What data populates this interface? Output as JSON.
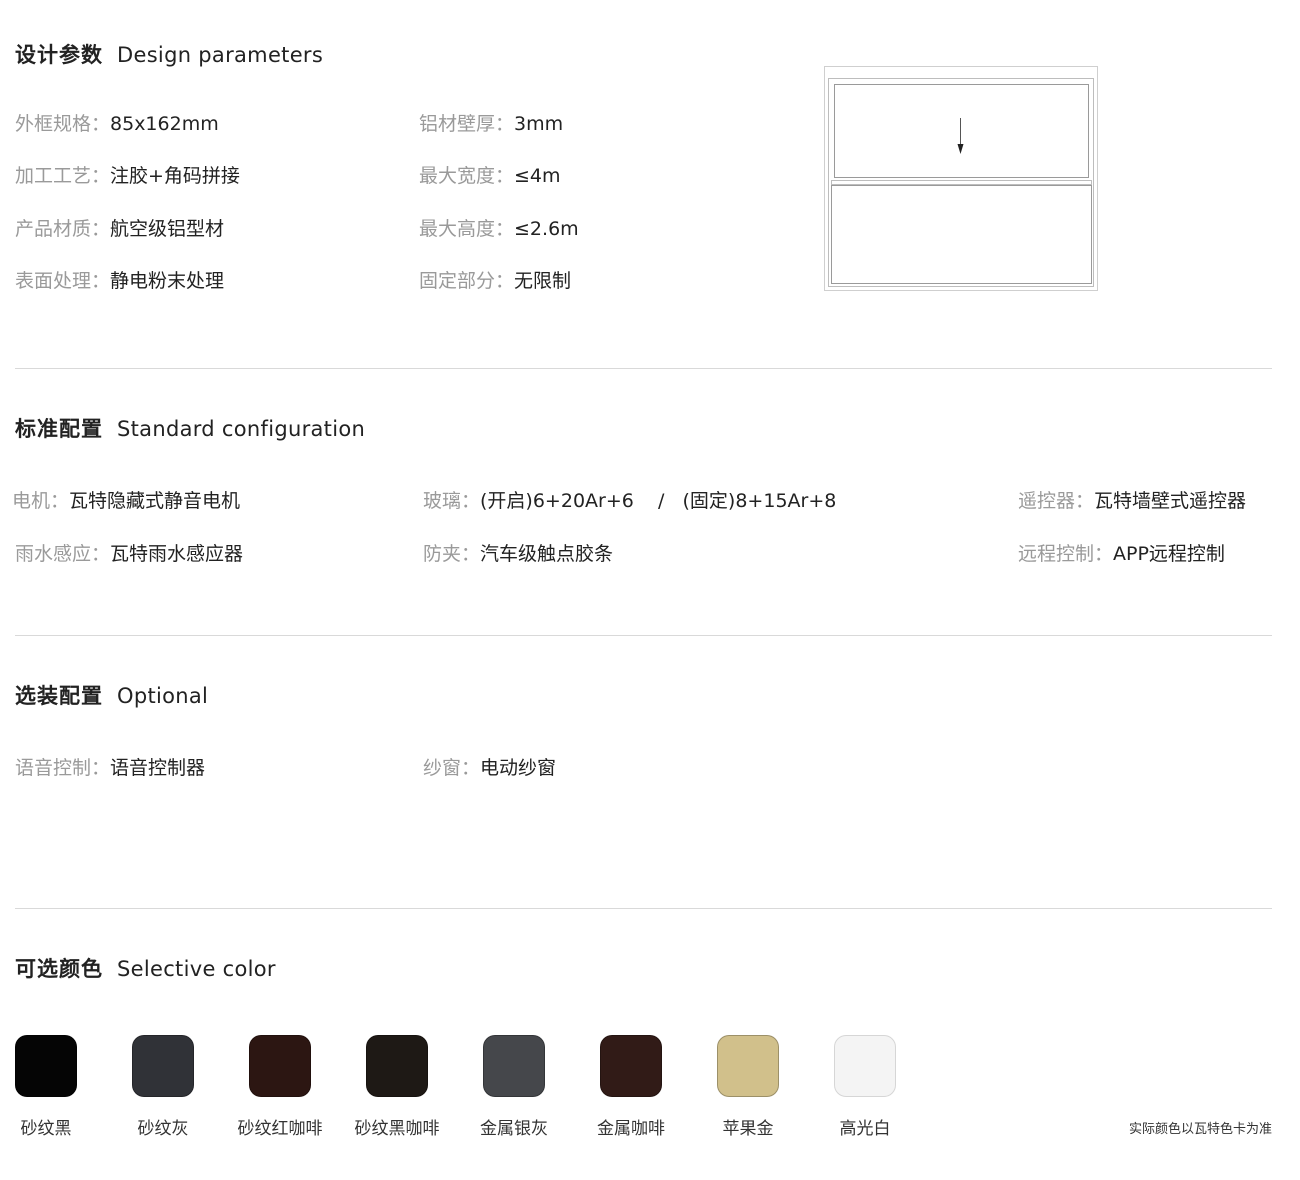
{
  "design": {
    "title": "设计参数",
    "subtitle": "Design parameters",
    "params": [
      {
        "k": "外框规格：",
        "v": "85x162mm"
      },
      {
        "k": "加工工艺：",
        "v": "注胶+角码拼接"
      },
      {
        "k": "产品材质：",
        "v": "航空级铝型材"
      },
      {
        "k": "表面处理：",
        "v": "静电粉末处理"
      },
      {
        "k": "铝材壁厚：",
        "v": "3mm"
      },
      {
        "k": "最大宽度：",
        "v": "≤4m"
      },
      {
        "k": "最大高度：",
        "v": "≤2.6m"
      },
      {
        "k": "固定部分：",
        "v": "无限制"
      }
    ]
  },
  "standard": {
    "title": "标准配置",
    "subtitle": "Standard configuration",
    "params": [
      {
        "k": "电机：",
        "v": "瓦特隐藏式静音电机"
      },
      {
        "k": "雨水感应：",
        "v": "瓦特雨水感应器"
      },
      {
        "k": "玻璃：",
        "v": "(开启)6+20Ar+6    /   (固定)8+15Ar+8"
      },
      {
        "k": "防夹：",
        "v": "汽车级触点胶条"
      },
      {
        "k": "遥控器：",
        "v": "瓦特墙壁式遥控器"
      },
      {
        "k": "远程控制：",
        "v": "APP远程控制"
      }
    ]
  },
  "optional": {
    "title": "选装配置",
    "subtitle": "Optional",
    "params": [
      {
        "k": "语音控制：",
        "v": "语音控制器"
      },
      {
        "k": "纱窗：",
        "v": "电动纱窗"
      }
    ]
  },
  "colors": {
    "title": "可选颜色",
    "subtitle": "Selective color",
    "items": [
      {
        "name": "砂纹黑",
        "color": "#050505"
      },
      {
        "name": "砂纹灰",
        "color": "#303237"
      },
      {
        "name": "砂纹红咖啡",
        "color": "#2c1612"
      },
      {
        "name": "砂纹黑咖啡",
        "color": "#1e1915"
      },
      {
        "name": "金属银灰",
        "color": "#45474b"
      },
      {
        "name": "金属咖啡",
        "color": "#311b17"
      },
      {
        "name": "苹果金",
        "color": "#d1c08b"
      },
      {
        "name": "高光白",
        "color": "#f4f4f4"
      }
    ],
    "note": "实际颜色以瓦特色卡为准"
  }
}
